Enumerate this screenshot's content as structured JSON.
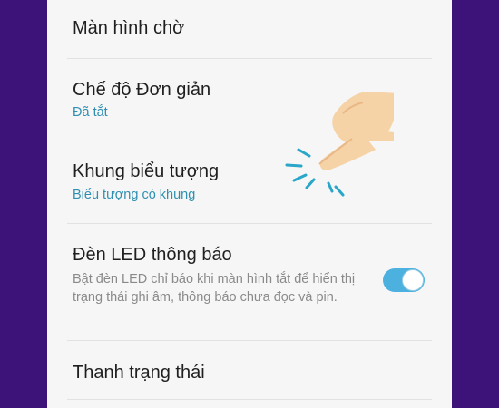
{
  "settings": {
    "items": [
      {
        "title": "Màn hình chờ"
      },
      {
        "title": "Chế độ Đơn giản",
        "subtitle": "Đã tắt"
      },
      {
        "title": "Khung biểu tượng",
        "subtitle": "Biểu tượng có khung"
      },
      {
        "title": "Đèn LED thông báo",
        "description": "Bật đèn LED chỉ báo khi màn hình tắt để hiển thị trạng thái ghi âm, thông báo chưa đọc và pin.",
        "toggle_on": true
      },
      {
        "title": "Thanh trạng thái"
      }
    ]
  },
  "overlay": {
    "icon": "tap-hand-icon"
  },
  "colors": {
    "background": "#3d137a",
    "panel": "#f6f6f6",
    "accent": "#2f8fb2",
    "toggle": "#4db1e0"
  }
}
